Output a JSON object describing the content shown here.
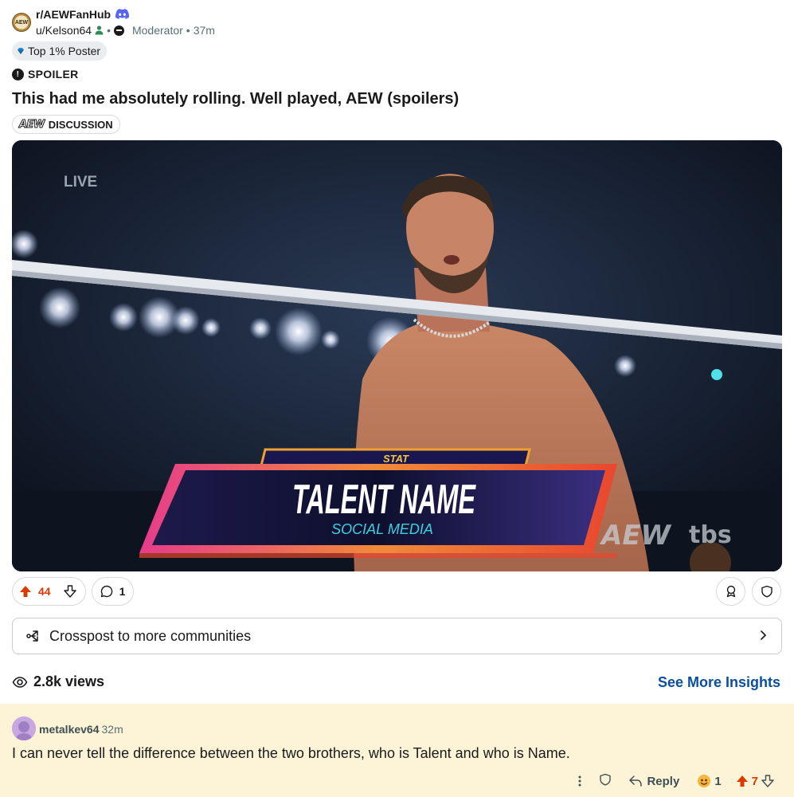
{
  "post": {
    "subreddit": "r/AEWFanHub",
    "subreddit_icon_text": "AEW",
    "author": "u/Kelson64",
    "author_role": "Moderator",
    "time_ago": "37m",
    "user_flair": "Top 1% Poster",
    "spoiler_label": "SPOILER",
    "title": "This had me absolutely rolling. Well played, AEW (spoilers)",
    "post_flair_logo": "AEW",
    "post_flair": "DISCUSSION"
  },
  "media": {
    "live_label": "LIVE",
    "lower_third_top": "STAT",
    "lower_third_name": "TALENT NAME",
    "lower_third_sub": "SOCIAL MEDIA",
    "bug_aew": "AEW",
    "bug_network": "tbs"
  },
  "actions": {
    "upvotes": "44",
    "comments": "1"
  },
  "crosspost": {
    "label": "Crosspost to more communities"
  },
  "stats": {
    "views": "2.8k views",
    "insights_link": "See More Insights"
  },
  "comment": {
    "username": "metalkev64",
    "time_ago": "32m",
    "body": "I can never tell the difference between the two brothers, who is Talent and who is Name.",
    "reply_label": "Reply",
    "award_count": "1",
    "score": "7"
  },
  "colors": {
    "upvote": "#d93a00",
    "link": "#0a4f9c",
    "comment_bg": "#fdf3d6"
  },
  "icons": [
    "discord-icon",
    "moderator-icon",
    "gem-icon",
    "spoiler-icon",
    "upvote-icon",
    "downvote-icon",
    "comment-icon",
    "award-icon",
    "share-icon",
    "crosspost-icon",
    "chevron-right-icon",
    "views-icon",
    "more-icon",
    "reply-icon"
  ]
}
